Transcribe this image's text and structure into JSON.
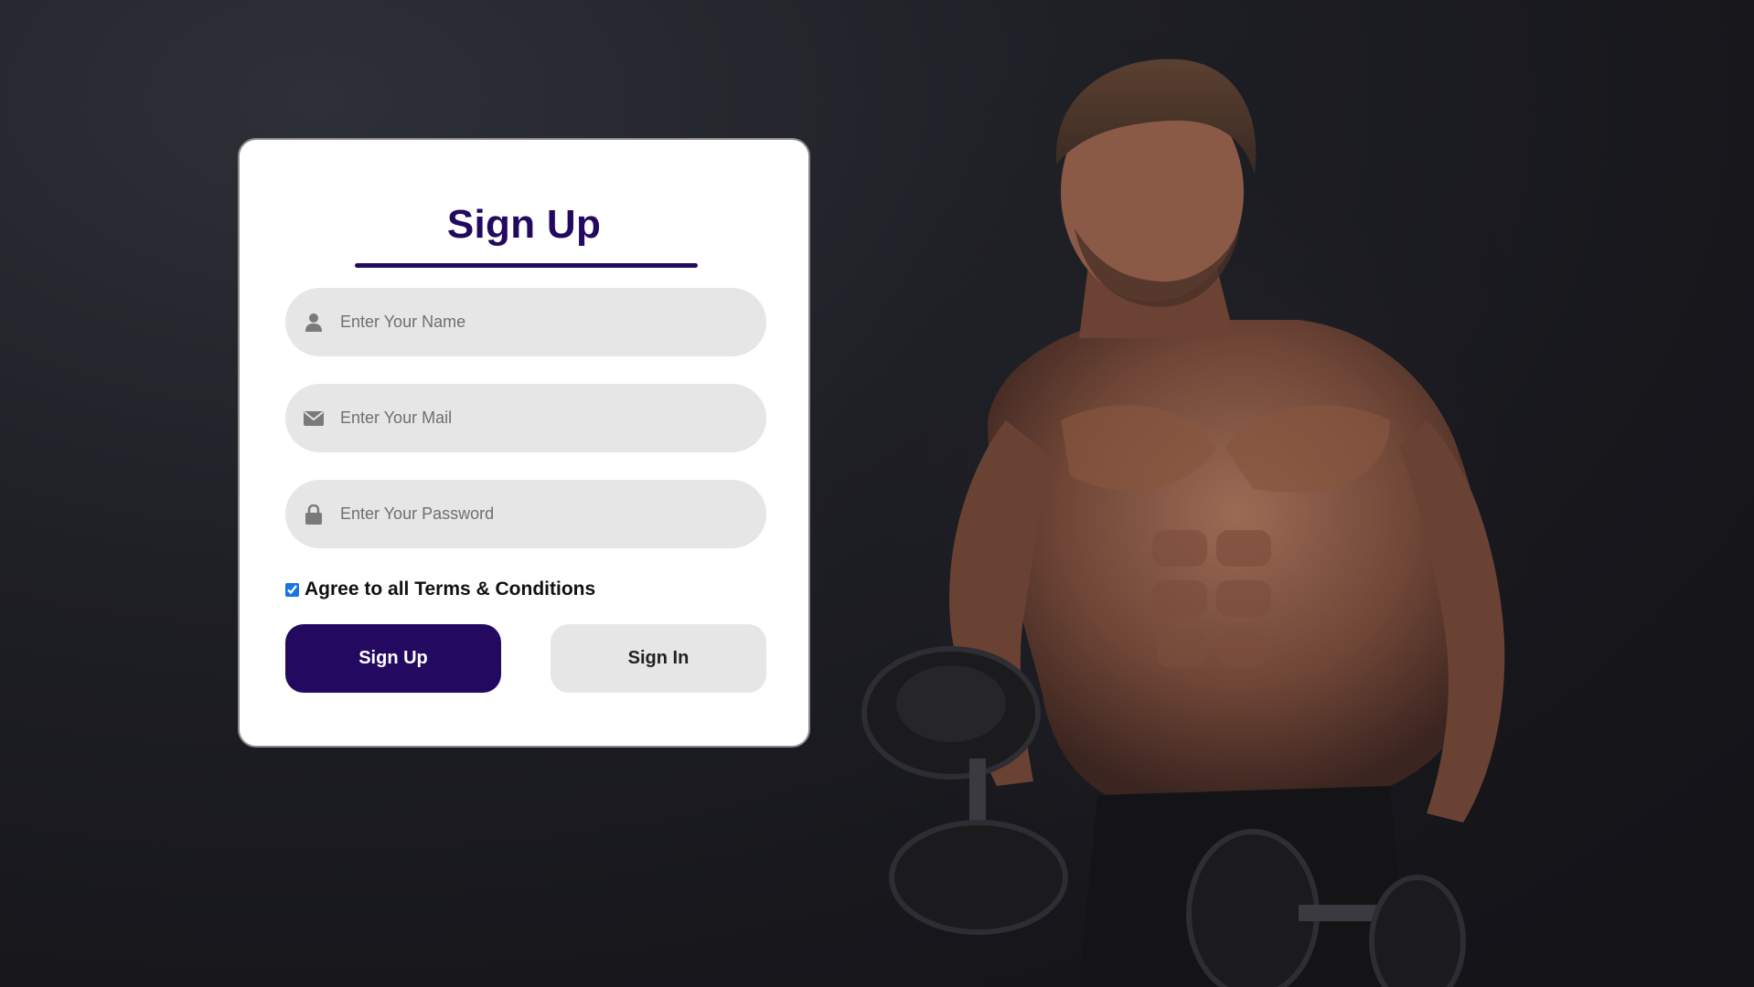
{
  "colors": {
    "accent": "#230a60",
    "field_background": "#e6e6e6",
    "card_background": "#ffffff",
    "page_background": "#1e1f25"
  },
  "hero": {
    "subject": "muscular man holding two dumbbells"
  },
  "form": {
    "title": "Sign Up",
    "fields": [
      {
        "icon": "user-icon",
        "placeholder": "Enter Your Name",
        "value": ""
      },
      {
        "icon": "envelope-icon",
        "placeholder": "Enter Your Mail",
        "value": ""
      },
      {
        "icon": "lock-icon",
        "placeholder": "Enter Your Password",
        "value": ""
      }
    ],
    "terms": {
      "checked": true,
      "label": "Agree to all Terms & Conditions"
    },
    "buttons": {
      "sign_up": "Sign Up",
      "sign_in": "Sign In"
    }
  }
}
